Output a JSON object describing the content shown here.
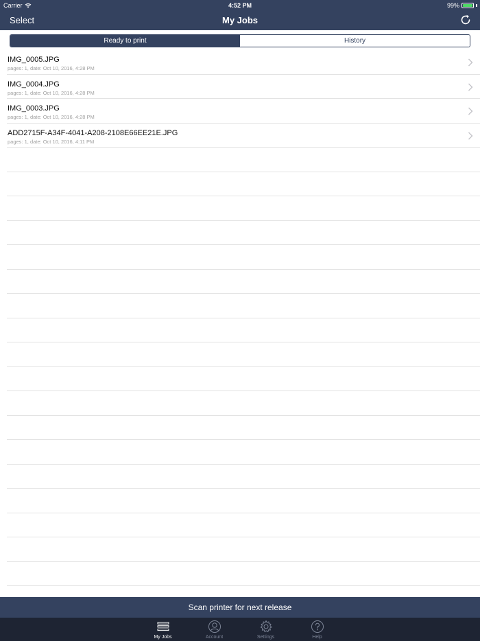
{
  "status_bar": {
    "carrier": "Carrier",
    "time": "4:52 PM",
    "battery": "99%",
    "battery_level": 0.99,
    "battery_color": "#4cd964"
  },
  "navbar": {
    "left_button": "Select",
    "title": "My Jobs",
    "right_icon": "refresh-icon"
  },
  "segments": [
    {
      "label": "Ready to print",
      "active": true
    },
    {
      "label": "History",
      "active": false
    }
  ],
  "jobs": [
    {
      "name": "IMG_0005.JPG",
      "meta": "pages: 1, date: Oct 10, 2016, 4:28 PM"
    },
    {
      "name": "IMG_0004.JPG",
      "meta": "pages: 1, date: Oct 10, 2016, 4:28 PM"
    },
    {
      "name": "IMG_0003.JPG",
      "meta": "pages: 1, date: Oct 10, 2016, 4:28 PM"
    },
    {
      "name": "ADD2715F-A34F-4041-A208-2108E66EE21E.JPG",
      "meta": "pages: 1, date: Oct 10, 2016, 4:11 PM"
    }
  ],
  "scan_button": "Scan printer for next release",
  "tabs": [
    {
      "label": "My Jobs",
      "icon": "list-icon",
      "active": true
    },
    {
      "label": "Account",
      "icon": "person-icon",
      "active": false
    },
    {
      "label": "Settings",
      "icon": "gear-icon",
      "active": false
    },
    {
      "label": "Help",
      "icon": "help-icon",
      "active": false
    }
  ],
  "colors": {
    "brand": "#34425f",
    "tabbar": "#1e2433"
  }
}
